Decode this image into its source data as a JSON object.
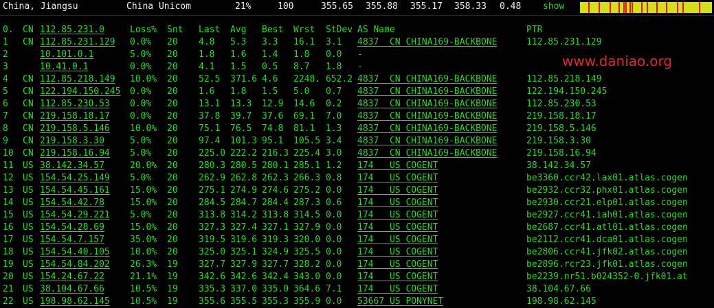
{
  "summary": {
    "location": "China, Jiangsu",
    "isp": "China Unicom",
    "loss": "21%",
    "count": "100",
    "last": "355.65",
    "avg": "355.88",
    "best": "355.17",
    "worst": "358.33",
    "stdev": "0.48",
    "show_label": "show"
  },
  "colors": {
    "background": "#000000",
    "text": "#2fd82f",
    "header_text": "#f0f0f0",
    "bar_fill": "#d7e015",
    "bar_tick": "#e4161b",
    "watermark": "#e0272b"
  },
  "columns": {
    "idx": "0.",
    "cc": "CN",
    "ip": "112.85.231.0",
    "loss": "Loss%",
    "snt": "Snt",
    "last": "Last",
    "avg": "Avg",
    "best": "Best",
    "wrst": "Wrst",
    "stdev": "StDev",
    "as": "AS Name",
    "ptr": "PTR"
  },
  "hops": [
    {
      "idx": "1",
      "cc": "CN",
      "ip": "112.85.231.129",
      "loss": "0.0%",
      "snt": "20",
      "last": "4.8",
      "avg": "5.3",
      "best": "3.3",
      "wrst": "16.1",
      "stdev": "3.1",
      "as": "4837  CN CHINA169-BACKBONE",
      "ptr": "112.85.231.129"
    },
    {
      "idx": "2",
      "cc": "",
      "ip": "10.101.0.1",
      "loss": "5.0%",
      "snt": "20",
      "last": "1.8",
      "avg": "1.6",
      "best": "1.4",
      "wrst": "1.8",
      "stdev": "0.0",
      "as": "-",
      "ptr": ""
    },
    {
      "idx": "3",
      "cc": "",
      "ip": "10.41.0.1",
      "loss": "0.0%",
      "snt": "20",
      "last": "4.1",
      "avg": "1.5",
      "best": "0.5",
      "wrst": "8.7",
      "stdev": "1.8",
      "as": "-",
      "ptr": ""
    },
    {
      "idx": "4",
      "cc": "CN",
      "ip": "112.85.218.149",
      "loss": "10.0%",
      "snt": "20",
      "last": "52.5",
      "avg": "371.6",
      "best": "4.6",
      "wrst": "2248.",
      "stdev": "652.2",
      "as": "4837  CN CHINA169-BACKBONE",
      "ptr": "112.85.218.149"
    },
    {
      "idx": "5",
      "cc": "CN",
      "ip": "122.194.150.245",
      "loss": "0.0%",
      "snt": "20",
      "last": "1.6",
      "avg": "1.8",
      "best": "1.5",
      "wrst": "5.0",
      "stdev": "0.7",
      "as": "4837  CN CHINA169-BACKBONE",
      "ptr": "122.194.150.245"
    },
    {
      "idx": "6",
      "cc": "CN",
      "ip": "112.85.230.53",
      "loss": "0.0%",
      "snt": "20",
      "last": "13.1",
      "avg": "13.3",
      "best": "12.9",
      "wrst": "14.6",
      "stdev": "0.2",
      "as": "4837  CN CHINA169-BACKBONE",
      "ptr": "112.85.230.53"
    },
    {
      "idx": "7",
      "cc": "CN",
      "ip": "219.158.18.17",
      "loss": "0.0%",
      "snt": "20",
      "last": "37.8",
      "avg": "39.7",
      "best": "37.6",
      "wrst": "69.1",
      "stdev": "7.0",
      "as": "4837  CN CHINA169-BACKBONE",
      "ptr": "219.158.18.17"
    },
    {
      "idx": "8",
      "cc": "CN",
      "ip": "219.158.5.146",
      "loss": "10.0%",
      "snt": "20",
      "last": "75.1",
      "avg": "76.5",
      "best": "74.8",
      "wrst": "81.1",
      "stdev": "1.3",
      "as": "4837  CN CHINA169-BACKBONE",
      "ptr": "219.158.5.146"
    },
    {
      "idx": "9",
      "cc": "CN",
      "ip": "219.158.3.30",
      "loss": "5.0%",
      "snt": "20",
      "last": "97.4",
      "avg": "101.3",
      "best": "95.1",
      "wrst": "105.5",
      "stdev": "3.4",
      "as": "4837  CN CHINA169-BACKBONE",
      "ptr": "219.158.3.30"
    },
    {
      "idx": "10",
      "cc": "CN",
      "ip": "219.158.16.94",
      "loss": "5.0%",
      "snt": "20",
      "last": "225.0",
      "avg": "222.2",
      "best": "216.3",
      "wrst": "225.4",
      "stdev": "3.0",
      "as": "4837  CN CHINA169-BACKBONE",
      "ptr": "219.158.16.94"
    },
    {
      "idx": "11",
      "cc": "US",
      "ip": "38.142.34.57",
      "loss": "20.0%",
      "snt": "20",
      "last": "280.3",
      "avg": "280.5",
      "best": "280.1",
      "wrst": "285.1",
      "stdev": "1.2",
      "as": "174   US COGENT",
      "ptr": "38.142.34.57"
    },
    {
      "idx": "12",
      "cc": "US",
      "ip": "154.54.25.149",
      "loss": "5.0%",
      "snt": "20",
      "last": "262.9",
      "avg": "262.8",
      "best": "262.3",
      "wrst": "266.3",
      "stdev": "0.8",
      "as": "174   US COGENT",
      "ptr": "be3360.ccr42.lax01.atlas.cogen"
    },
    {
      "idx": "13",
      "cc": "US",
      "ip": "154.54.45.161",
      "loss": "15.0%",
      "snt": "20",
      "last": "275.1",
      "avg": "274.9",
      "best": "274.6",
      "wrst": "275.2",
      "stdev": "0.0",
      "as": "174   US COGENT",
      "ptr": "be2932.ccr32.phx01.atlas.cogen"
    },
    {
      "idx": "14",
      "cc": "US",
      "ip": "154.54.42.78",
      "loss": "15.0%",
      "snt": "20",
      "last": "284.5",
      "avg": "284.7",
      "best": "284.4",
      "wrst": "287.3",
      "stdev": "0.6",
      "as": "174   US COGENT",
      "ptr": "be2930.ccr21.elp01.atlas.cogen"
    },
    {
      "idx": "15",
      "cc": "US",
      "ip": "154.54.29.221",
      "loss": "5.0%",
      "snt": "20",
      "last": "313.8",
      "avg": "314.2",
      "best": "313.8",
      "wrst": "314.5",
      "stdev": "0.0",
      "as": "174   US COGENT",
      "ptr": "be2927.ccr41.iah01.atlas.cogen"
    },
    {
      "idx": "16",
      "cc": "US",
      "ip": "154.54.28.69",
      "loss": "15.0%",
      "snt": "20",
      "last": "327.3",
      "avg": "327.4",
      "best": "327.1",
      "wrst": "327.9",
      "stdev": "0.0",
      "as": "174   US COGENT",
      "ptr": "be2687.ccr41.atl01.atlas.cogen"
    },
    {
      "idx": "17",
      "cc": "US",
      "ip": "154.54.7.157",
      "loss": "35.0%",
      "snt": "20",
      "last": "319.5",
      "avg": "319.6",
      "best": "319.3",
      "wrst": "320.0",
      "stdev": "0.0",
      "as": "174   US COGENT",
      "ptr": "be2112.ccr41.dca01.atlas.cogen"
    },
    {
      "idx": "18",
      "cc": "US",
      "ip": "154.54.40.105",
      "loss": "10.0%",
      "snt": "20",
      "last": "325.0",
      "avg": "325.1",
      "best": "324.9",
      "wrst": "325.5",
      "stdev": "0.0",
      "as": "174   US COGENT",
      "ptr": "be2806.ccr41.jfk02.atlas.cogen"
    },
    {
      "idx": "19",
      "cc": "US",
      "ip": "154.54.84.202",
      "loss": "26.3%",
      "snt": "19",
      "last": "327.7",
      "avg": "327.9",
      "best": "327.7",
      "wrst": "328.2",
      "stdev": "0.0",
      "as": "174   US COGENT",
      "ptr": "be2896.rcr23.jfk01.atlas.cogen"
    },
    {
      "idx": "20",
      "cc": "US",
      "ip": "154.24.67.22",
      "loss": "21.1%",
      "snt": "19",
      "last": "342.6",
      "avg": "342.6",
      "best": "342.4",
      "wrst": "343.0",
      "stdev": "0.0",
      "as": "174   US COGENT",
      "ptr": "be2239.nr51.b024352-0.jfk01.at"
    },
    {
      "idx": "21",
      "cc": "US",
      "ip": "38.104.67.66",
      "loss": "10.5%",
      "snt": "19",
      "last": "335.3",
      "avg": "337.0",
      "best": "335.0",
      "wrst": "364.6",
      "stdev": "7.1",
      "as": "174   US COGENT",
      "ptr": "38.104.67.66"
    },
    {
      "idx": "22",
      "cc": "US",
      "ip": "198.98.62.145",
      "loss": "10.5%",
      "snt": "19",
      "last": "355.6",
      "avg": "355.5",
      "best": "355.3",
      "wrst": "355.9",
      "stdev": "0.0",
      "as": "53667 US PONYNET",
      "ptr": "198.98.62.145"
    }
  ],
  "watermark": "www.daniao.org"
}
